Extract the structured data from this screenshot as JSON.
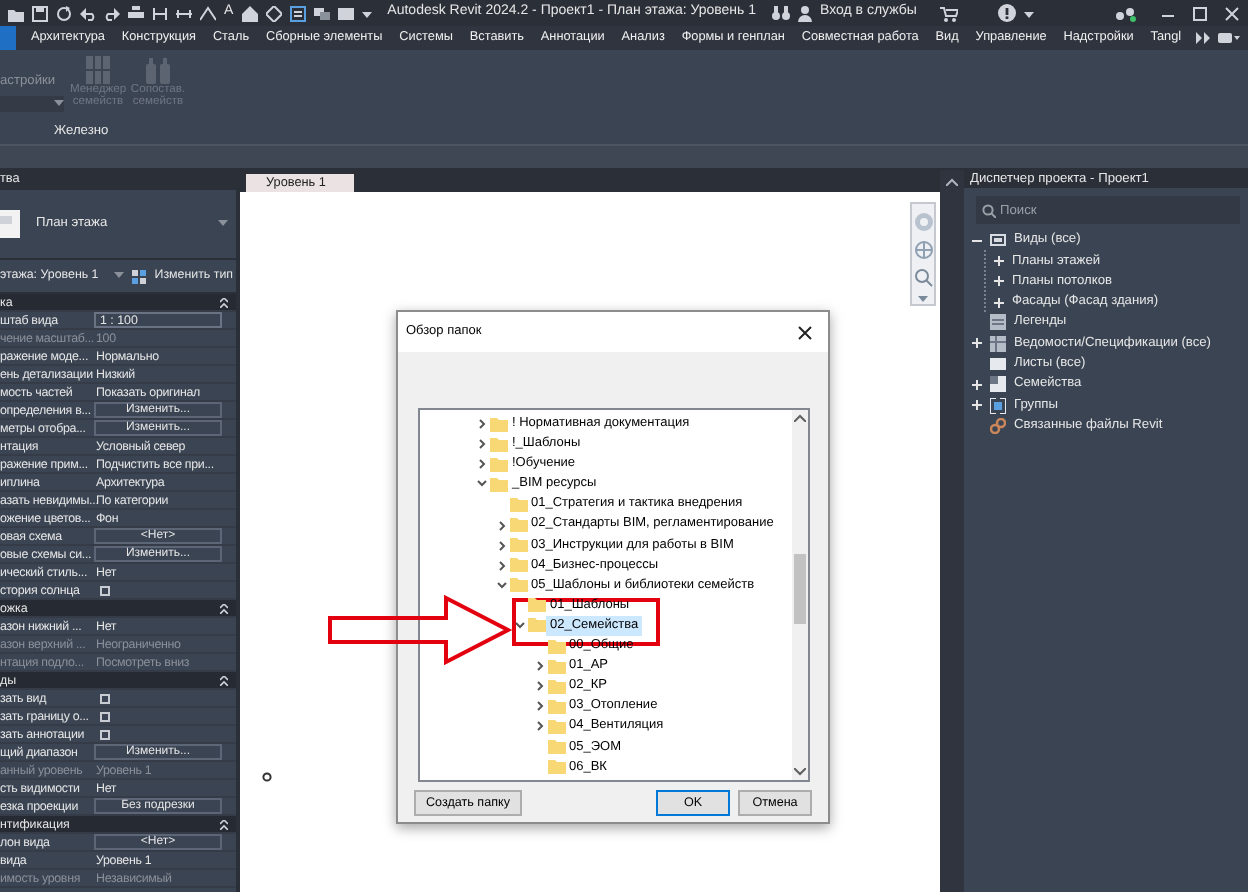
{
  "title_bar": {
    "text_tool": "A",
    "title": "Autodesk Revit 2024.2 - Проект1 - План этажа: Уровень 1",
    "sign_in": "Вход в службы"
  },
  "ribbon_tabs": [
    {
      "selected": true
    },
    {
      "label": "Архитектура",
      "selected": false
    },
    {
      "label": "Конструкция",
      "selected": false
    },
    {
      "label": "Сталь",
      "selected": false
    },
    {
      "label": "Сборные элементы",
      "selected": false
    },
    {
      "label": "Системы",
      "selected": false
    },
    {
      "label": "Вставить",
      "selected": false
    },
    {
      "label": "Аннотации",
      "selected": false
    },
    {
      "label": "Анализ",
      "selected": false
    },
    {
      "label": "Формы и генплан",
      "selected": false
    },
    {
      "label": "Совместная работа",
      "selected": false
    },
    {
      "label": "Вид",
      "selected": false
    },
    {
      "label": "Управление",
      "selected": false
    },
    {
      "label": "Надстройки",
      "selected": false
    },
    {
      "label": "Tangl",
      "selected": false
    }
  ],
  "ribbon": {
    "panel_label": "астройки",
    "buttons": [
      {
        "label": "Менеджер семейств",
        "disabled": true
      },
      {
        "label": "Сопостав. семейств",
        "disabled": true
      }
    ],
    "panel_title": "Железно"
  },
  "properties": {
    "title": "тва",
    "type_name": "План этажа",
    "instance_selector": "этажа: Уровень 1",
    "edit_type": "Изменить тип",
    "rows": [
      {
        "kind": "header",
        "label": "ка"
      },
      {
        "kind": "field",
        "label": "штаб вида",
        "value": "1 : 100",
        "disabled": false
      },
      {
        "kind": "text",
        "label": "чение масштаб...",
        "value": "100",
        "disabled": true
      },
      {
        "kind": "text",
        "label": "ражение моде...",
        "value": "Нормально",
        "disabled": false
      },
      {
        "kind": "text",
        "label": "ень детализации",
        "value": "Низкий",
        "disabled": false
      },
      {
        "kind": "text",
        "label": "мость частей",
        "value": "Показать оригинал",
        "disabled": false
      },
      {
        "kind": "button",
        "label": "определения в...",
        "value": "Изменить...",
        "disabled": false
      },
      {
        "kind": "button",
        "label": "метры отобра...",
        "value": "Изменить...",
        "disabled": false
      },
      {
        "kind": "text",
        "label": "нтация",
        "value": "Условный север",
        "disabled": false
      },
      {
        "kind": "text",
        "label": "ражение прим...",
        "value": "Подчистить все при...",
        "disabled": false
      },
      {
        "kind": "text",
        "label": "иплина",
        "value": "Архитектура",
        "disabled": false
      },
      {
        "kind": "text",
        "label": "азать невидимы...",
        "value": "По категории",
        "disabled": false
      },
      {
        "kind": "text",
        "label": "ожение цветов...",
        "value": "Фон",
        "disabled": false
      },
      {
        "kind": "button",
        "label": "овая схема",
        "value": "<Нет>",
        "disabled": false
      },
      {
        "kind": "button",
        "label": "овые схемы си...",
        "value": "Изменить...",
        "disabled": false
      },
      {
        "kind": "text",
        "label": "ический стиль...",
        "value": "Нет",
        "disabled": false
      },
      {
        "kind": "checkbox",
        "label": "стория солнца",
        "checked": false,
        "disabled": false
      },
      {
        "kind": "header",
        "label": "ожка"
      },
      {
        "kind": "text",
        "label": "азон нижний ...",
        "value": "Нет",
        "disabled": false
      },
      {
        "kind": "text",
        "label": "азон верхний ...",
        "value": "Неограниченно",
        "disabled": true
      },
      {
        "kind": "text",
        "label": "нтация подло...",
        "value": "Посмотреть вниз",
        "disabled": true
      },
      {
        "kind": "header",
        "label": "ды"
      },
      {
        "kind": "checkbox",
        "label": "зать вид",
        "checked": false,
        "disabled": false
      },
      {
        "kind": "checkbox",
        "label": "зать границу о...",
        "checked": false,
        "disabled": false
      },
      {
        "kind": "checkbox",
        "label": "зать аннотации",
        "checked": false,
        "disabled": false
      },
      {
        "kind": "button",
        "label": "щий диапазон",
        "value": "Изменить...",
        "disabled": false
      },
      {
        "kind": "text",
        "label": "анный уровень",
        "value": "Уровень 1",
        "disabled": true
      },
      {
        "kind": "text",
        "label": "сть видимости",
        "value": "Нет",
        "disabled": false
      },
      {
        "kind": "button",
        "label": "езка проекции",
        "value": "Без подрезки",
        "disabled": false
      },
      {
        "kind": "header",
        "label": "нтификация"
      },
      {
        "kind": "button",
        "label": "лон вида",
        "value": "<Нет>",
        "disabled": false
      },
      {
        "kind": "text",
        "label": "вида",
        "value": "Уровень 1",
        "disabled": false
      },
      {
        "kind": "text",
        "label": "имость уровня",
        "value": "Независимый",
        "disabled": true
      }
    ]
  },
  "view": {
    "tab": "Уровень 1"
  },
  "project_browser": {
    "title": "Диспетчер проекта - Проект1",
    "search": {
      "placeholder": "Поиск"
    },
    "tree": [
      {
        "kind": "views",
        "label": "Виды (все)",
        "expanded": true,
        "children": [
          {
            "label": "Планы этажей",
            "expanded": false
          },
          {
            "label": "Планы потолков",
            "expanded": false
          },
          {
            "label": "Фасады (Фасад здания)",
            "expanded": false
          }
        ]
      },
      {
        "kind": "legends",
        "label": "Легенды"
      },
      {
        "kind": "schedules",
        "label": "Ведомости/Спецификации (все)",
        "expanded": false
      },
      {
        "kind": "sheets",
        "label": "Листы (все)"
      },
      {
        "kind": "families",
        "label": "Семейства",
        "expanded": false
      },
      {
        "kind": "groups",
        "label": "Группы",
        "expanded": false
      },
      {
        "kind": "links",
        "label": "Связанные файлы Revit"
      }
    ]
  },
  "dialog": {
    "title": "Обзор папок",
    "tree": [
      {
        "label": "! Нормативная документация",
        "expanded": false,
        "selected": false
      },
      {
        "label": "!_Шаблоны",
        "expanded": false,
        "selected": false
      },
      {
        "label": "!Обучение",
        "expanded": false,
        "selected": false
      },
      {
        "label": "_BIM ресурсы",
        "expanded": true,
        "selected": false,
        "children": [
          {
            "label": "01_Стратегия и тактика внедрения",
            "selected": false
          },
          {
            "label": "02_Стандарты BIM, регламентирование",
            "expanded": false,
            "selected": false
          },
          {
            "label": "03_Инструкции для работы в BIM",
            "expanded": false,
            "selected": false
          },
          {
            "label": "04_Бизнес-процессы",
            "expanded": false,
            "selected": false
          },
          {
            "label": "05_Шаблоны и библиотеки семейств",
            "expanded": true,
            "selected": false,
            "children": [
              {
                "label": "01_Шаблоны",
                "selected": false
              },
              {
                "label": "02_Семейства",
                "expanded": true,
                "selected": true,
                "children": [
                  {
                    "label": "00_Общие",
                    "selected": false
                  },
                  {
                    "label": "01_АР",
                    "expanded": false,
                    "selected": false
                  },
                  {
                    "label": "02_КР",
                    "expanded": false,
                    "selected": false
                  },
                  {
                    "label": "03_Отопление",
                    "expanded": false,
                    "selected": false
                  },
                  {
                    "label": "04_Вентиляция",
                    "expanded": false,
                    "selected": false
                  },
                  {
                    "label": "05_ЭОМ",
                    "selected": false
                  },
                  {
                    "label": "06_ВК",
                    "selected": false
                  }
                ]
              }
            ]
          }
        ]
      }
    ],
    "buttons": [
      {
        "kind": "new-folder",
        "label": "Создать папку"
      },
      {
        "kind": "ok",
        "label": "OK"
      },
      {
        "kind": "cancel",
        "label": "Отмена"
      }
    ]
  }
}
